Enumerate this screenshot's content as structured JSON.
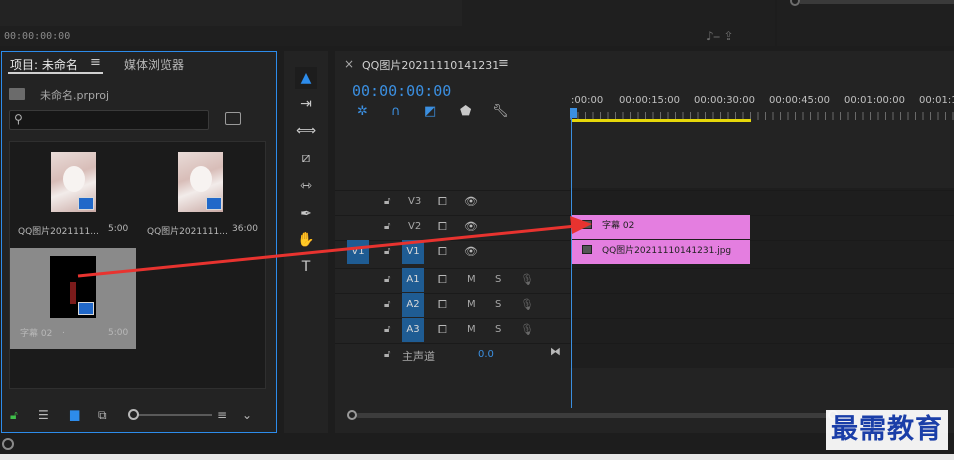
{
  "top": {
    "timecode": "00:00:00:00"
  },
  "project": {
    "tab_label": "项目: 未命名",
    "media_tab_label": "媒体浏览器",
    "project_file": "未命名.prproj",
    "items": [
      {
        "label": "QQ图片2021111...",
        "duration": "5:00"
      },
      {
        "label": "QQ图片2021111...",
        "duration": "36:00"
      },
      {
        "label": "字幕 02",
        "duration": "5:00"
      }
    ]
  },
  "timeline": {
    "sequence_title": "QQ图片20211110141231",
    "timecode": "00:00:00:00",
    "ruler_labels": [
      ":00:00",
      "00:00:15:00",
      "00:00:30:00",
      "00:00:45:00",
      "00:01:00:00",
      "00:01:1"
    ],
    "tracks": {
      "v3": "V3",
      "v2": "V2",
      "v1": "V1",
      "v1_source": "V1",
      "a1": "A1",
      "a2": "A2",
      "a3": "A3",
      "m": "M",
      "s": "S",
      "master": "主声道",
      "master_value": "0.0"
    },
    "clips": {
      "v2": "字幕 02",
      "v1": "QQ图片20211110141231.jpg"
    }
  },
  "watermark": "最需教育",
  "colors": {
    "accent": "#2d8ceb",
    "clip": "#e47ee0",
    "work_area": "#e6d70a",
    "arrow": "#e8332f"
  }
}
